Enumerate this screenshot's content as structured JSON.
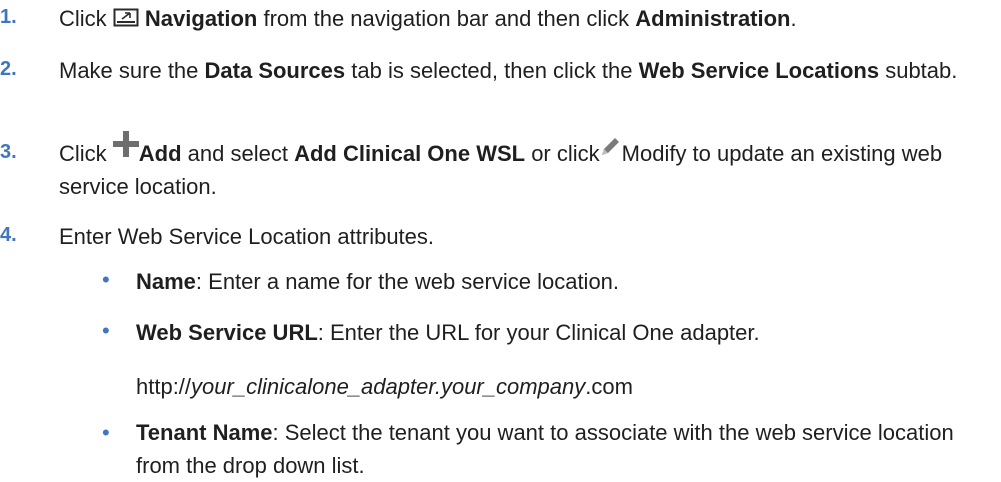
{
  "steps": [
    {
      "num": "1.",
      "p1": "Click ",
      "nav_label": "Navigation",
      "p2": " from the navigation bar and then click ",
      "admin_label": "Administration",
      "p3": "."
    },
    {
      "num": "2.",
      "p1": "Make sure the ",
      "tab_label": "Data Sources",
      "p2": " tab is selected, then click the ",
      "subtab_label": "Web Service Locations",
      "p3": " subtab."
    },
    {
      "num": "3.",
      "p1": "Click ",
      "add_label": "Add",
      "p2": " and select ",
      "add_c1_label": "Add Clinical One WSL",
      "p3": " or click",
      "p4": "Modify to update an existing web service location."
    },
    {
      "num": "4.",
      "text": "Enter Web Service Location attributes."
    }
  ],
  "bullets": [
    {
      "term": "Name",
      "desc": ": Enter a name for the web service location."
    },
    {
      "term": "Web Service URL",
      "desc": ": Enter the URL for your Clinical One adapter."
    },
    {
      "term": "Tenant Name",
      "desc": ": Select the tenant you want to associate with the web service location from the drop down list."
    }
  ],
  "url_example": {
    "prefix": "http://",
    "italic": "your_clinicalone_adapter.your_company",
    "suffix": ".com"
  },
  "icons": {
    "navigation": "navigation-icon",
    "add": "plus-icon",
    "modify": "pencil-icon"
  },
  "colors": {
    "step_number": "#3f76bf",
    "bullet": "#3f76bf",
    "add_icon": "#6e6e6e",
    "modify_icon": "#7a7a7a"
  }
}
